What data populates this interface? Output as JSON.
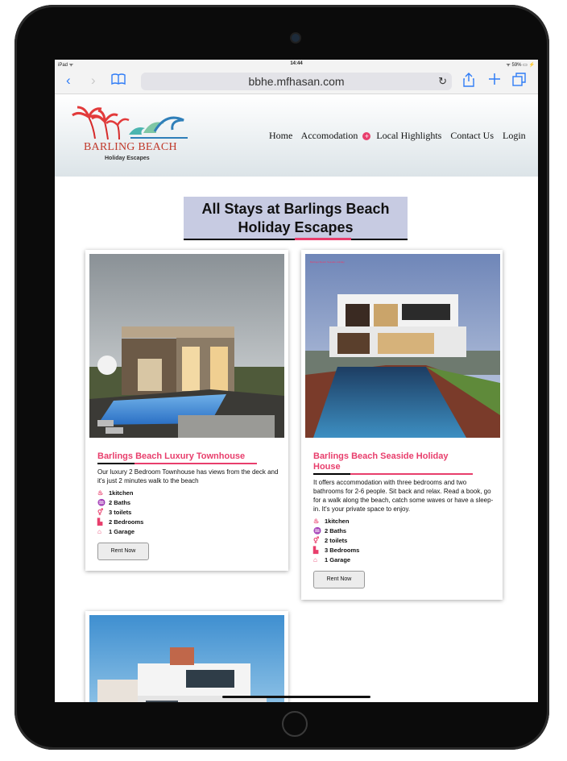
{
  "statusbar": {
    "device": "iPad ᯤ",
    "time": "14:44",
    "battery": "ᯤ 59% ▭ ⚡"
  },
  "browser": {
    "url": "bbhe.mfhasan.com",
    "icons": {
      "back": "chevron-left-icon",
      "forward": "chevron-right-icon",
      "bookmarks": "book-icon",
      "reload": "reload-icon",
      "share": "share-icon",
      "new_tab": "plus-icon",
      "tabs": "tabs-icon"
    }
  },
  "site": {
    "logo_text": "BARLING BEACH",
    "logo_subtitle": "Holiday Escapes",
    "nav": [
      "Home",
      "Accomodation",
      "Local Highlights",
      "Contact Us",
      "Login"
    ],
    "page_title_line1": "All Stays at Barlings Beach",
    "page_title_line2": "Holiday Escapes",
    "colors": {
      "accent": "#e83e6c",
      "title_bg": "#c7cbe2"
    }
  },
  "listings": [
    {
      "title": "Barlings Beach Luxury Townhouse",
      "description": "Our luxury 2 Bedroom Townhouse has views from the deck and it's just 2 minutes walk to the beach",
      "features": [
        "1kitchen",
        "2 Baths",
        "3 toilets",
        "2 Bedrooms",
        "1 Garage"
      ],
      "button": "Rent Now"
    },
    {
      "title": "Barlings Beach Seaside Holiday House",
      "description": "It offers accommodation with three bedrooms and two bathrooms for 2-6 people. Sit back and relax. Read a book, go for a walk along the beach, catch some waves or have a sleep-in. It's your private space to enjoy.",
      "features": [
        "1kitchen",
        "2 Baths",
        "2 toilets",
        "3 Bedrooms",
        "1 Garage"
      ],
      "button": "Rent Now",
      "photo_caption": "Barlings Beach Seaside Holiday"
    }
  ]
}
